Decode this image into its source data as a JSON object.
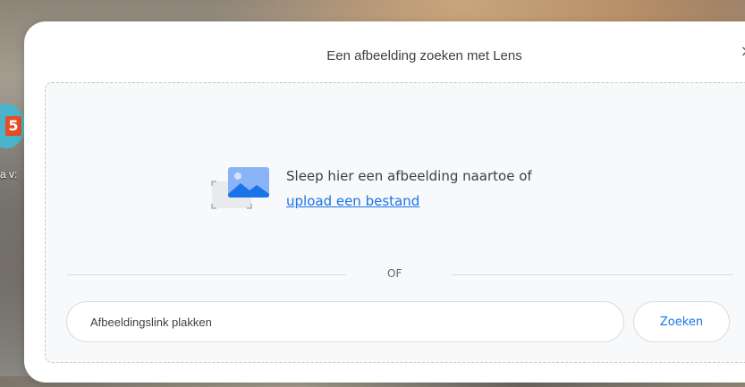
{
  "dialog": {
    "title": "Een afbeelding zoeken met Lens",
    "close_icon": "close-icon"
  },
  "drop_zone": {
    "illustration_icon": "image-placeholder-icon",
    "instruction": "Sleep hier een afbeelding naartoe of",
    "upload_link": "upload een bestand",
    "divider_label": "OF"
  },
  "url_form": {
    "placeholder": "Afbeeldingslink plakken",
    "value": "",
    "search_label": "Zoeken"
  },
  "desktop": {
    "icon_name": "html5-app-icon",
    "icon_glyph": "5",
    "label_fragment": "a v:"
  },
  "colors": {
    "accent": "#1a73e8",
    "text": "#3c4043",
    "border": "#dadce0"
  }
}
